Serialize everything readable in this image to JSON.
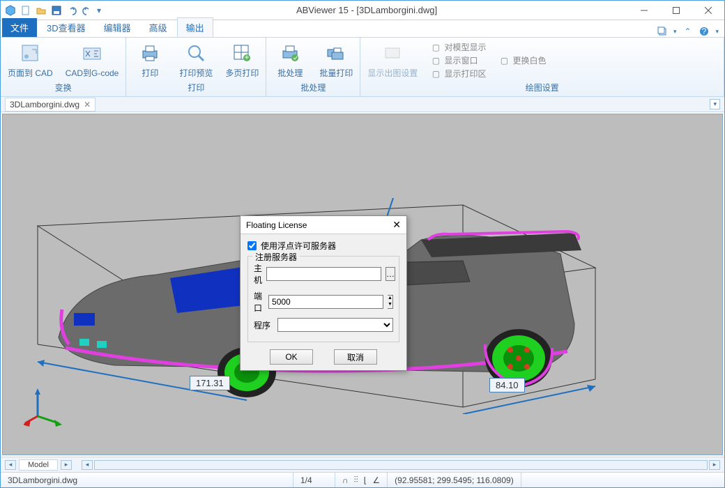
{
  "title": "ABViewer 15 - [3DLamborgini.dwg]",
  "tabs": {
    "file": "文件",
    "viewer3d": "3D查看器",
    "editor": "编辑器",
    "advanced": "高级",
    "output": "输出"
  },
  "ribbon": {
    "convert": {
      "title": "变换",
      "page_to_cad": "页面到 CAD",
      "cad_to_gcode": "CAD到G-code"
    },
    "print": {
      "title": "打印",
      "print": "打印",
      "preview": "打印预览",
      "multipage": "多页打印"
    },
    "batch": {
      "title": "批处理",
      "batch": "批处理",
      "batch_print": "批量打印"
    },
    "plot": {
      "title": "绘图设置",
      "show_plot_settings": "显示出图设置",
      "show_by_model": "对模型显示",
      "change_white": "更换白色",
      "show_window": "显示窗口",
      "show_print_area": "显示打印区"
    }
  },
  "doc_tab": "3DLamborgini.dwg",
  "dimensions": {
    "left": "171.31",
    "right": "84.10"
  },
  "dialog": {
    "title": "Floating License",
    "use_server": "使用浮点许可服务器",
    "group_title": "注册服务器",
    "host_label": "主机",
    "host_value": "",
    "port_label": "端口",
    "port_value": "5000",
    "program_label": "程序",
    "program_value": "",
    "ok": "OK",
    "cancel": "取消"
  },
  "model_tab": "Model",
  "status": {
    "file": "3DLamborgini.dwg",
    "page": "1/4",
    "coords": "(92.95581; 299.5495; 116.0809)"
  }
}
